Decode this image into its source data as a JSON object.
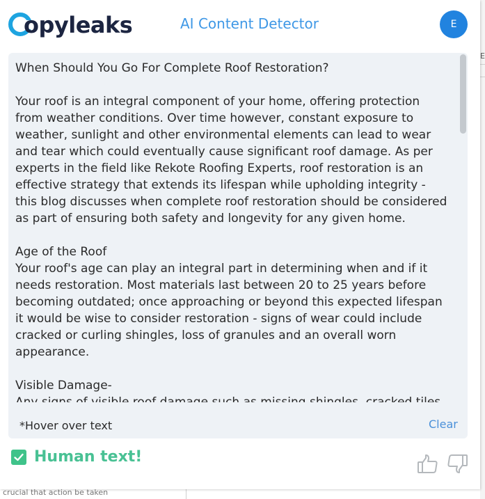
{
  "background": {
    "right_mark": "E",
    "bottom_text": "crucial that action be taken"
  },
  "header": {
    "logo_text": "opyleaks",
    "title": "AI Content Detector",
    "avatar_initial": "E"
  },
  "content": {
    "text": "When Should You Go For Complete Roof Restoration?\n\nYour roof is an integral component of your home, offering protection from weather conditions. Over time however, constant exposure to weather, sunlight and other environmental elements can lead to wear and tear which could eventually cause significant roof damage. As per experts in the field like Rekote Roofing Experts, roof restoration is an effective strategy that extends its lifespan while upholding integrity - this blog discusses when complete roof restoration should be considered as part of ensuring both safety and longevity for any given home.\n\nAge of the Roof\nYour roof's age can play an integral part in determining when and if it needs restoration. Most materials last between 20 to 25 years before becoming outdated; once approaching or beyond this expected lifespan it would be wise to consider restoration - signs of wear could include cracked or curling shingles, loss of granules and an overall worn appearance.\n\nVisible Damage-\nAny signs of visible roof damage such as missing shingles, cracked tiles or significant wear should prompt you to consider restoration as soon as possible."
  },
  "footer": {
    "hint": "*Hover over text",
    "clear_label": "Clear"
  },
  "result": {
    "label": "Human text!"
  },
  "colors": {
    "brand_blue": "#1ea4e0",
    "title_blue": "#3f98e6",
    "avatar_blue": "#2183df",
    "result_green": "#49c194",
    "panel_bg": "#eef2f6"
  }
}
